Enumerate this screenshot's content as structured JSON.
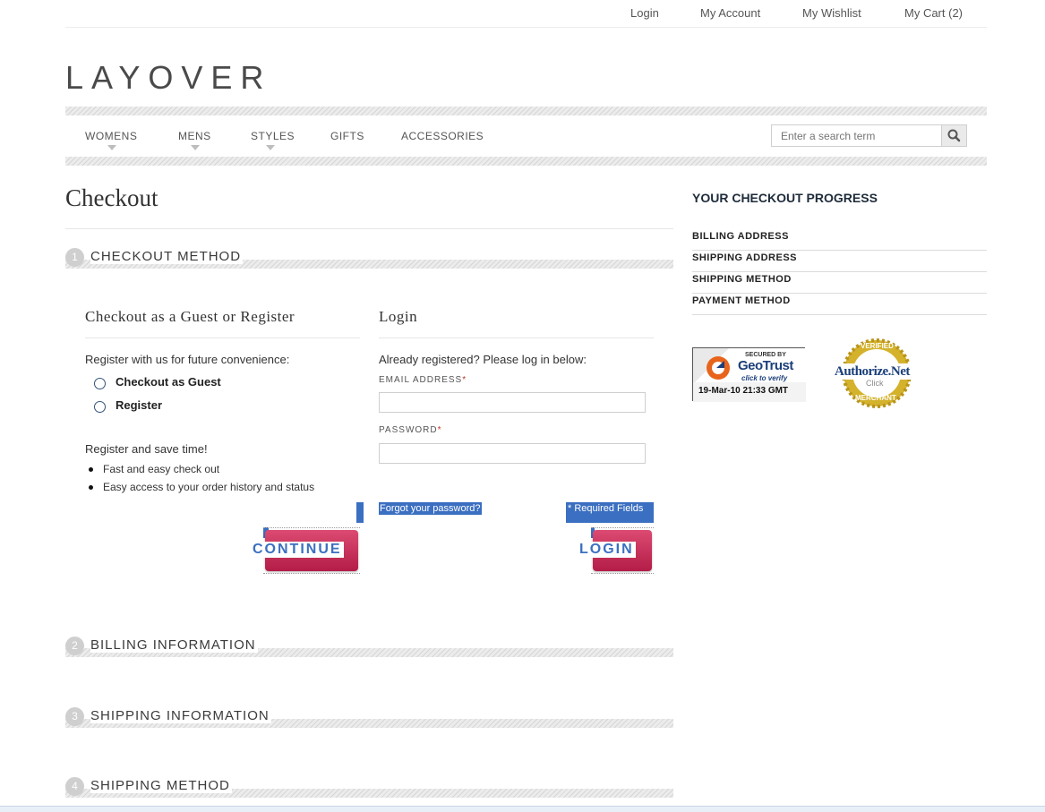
{
  "header": {
    "links": [
      "Login",
      "My Account",
      "My Wishlist",
      "My Cart (2)"
    ],
    "logo": "LAYOVER"
  },
  "nav": {
    "items": [
      "WOMENS",
      "MENS",
      "STYLES",
      "GIFTS",
      "ACCESSORIES"
    ],
    "search_placeholder": "Enter a search term"
  },
  "page": {
    "title": "Checkout"
  },
  "steps": [
    {
      "num": "1",
      "label": "CHECKOUT METHOD"
    },
    {
      "num": "2",
      "label": "BILLING INFORMATION"
    },
    {
      "num": "3",
      "label": "SHIPPING INFORMATION"
    },
    {
      "num": "4",
      "label": "SHIPPING METHOD"
    }
  ],
  "guest": {
    "title": "Checkout as a Guest or Register",
    "intro": "Register with us for future convenience:",
    "options": [
      "Checkout as Guest",
      "Register"
    ],
    "save_time": "Register and save time!",
    "benefits": [
      "Fast and easy check out",
      "Easy access to your order history and status"
    ],
    "continue_label": "CONTINUE"
  },
  "login": {
    "title": "Login",
    "intro": "Already registered? Please log in below:",
    "email_label": "EMAIL ADDRESS",
    "password_label": "PASSWORD",
    "required_mark": "*",
    "forgot": "Forgot your password?",
    "required_note": "* Required Fields",
    "login_label": "LOGIN"
  },
  "sidebar": {
    "title": "YOUR CHECKOUT PROGRESS",
    "items": [
      "BILLING ADDRESS",
      "SHIPPING ADDRESS",
      "SHIPPING METHOD",
      "PAYMENT METHOD"
    ]
  },
  "badges": {
    "geotrust": {
      "secured": "SECURED BY",
      "brand": "GeoTrust",
      "verify": "click to verify",
      "date": "19-Mar-10 21:33 GMT"
    },
    "authorize": {
      "top": "VERIFIED",
      "brand": "Authorize.Net",
      "click": "Click",
      "bottom": "MERCHANT"
    }
  },
  "colors": {
    "accent": "#c41e4a",
    "selection": "#3b6fc1"
  }
}
